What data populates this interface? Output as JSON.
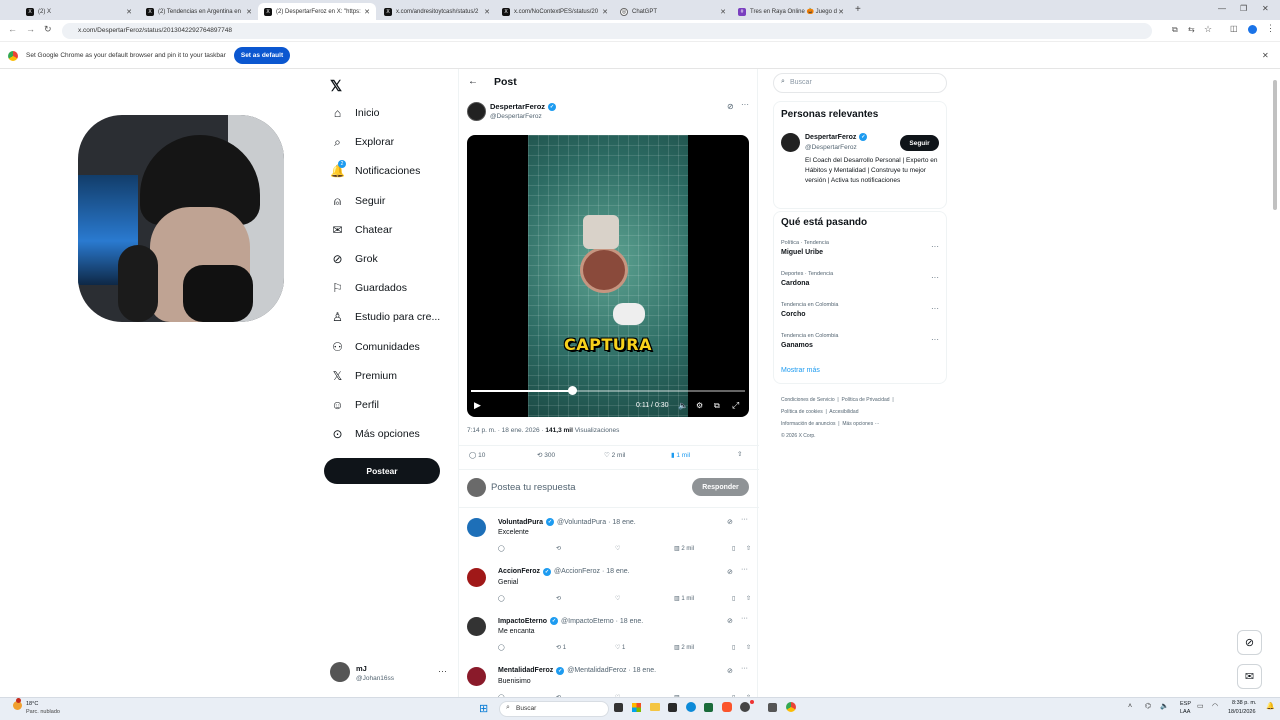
{
  "browser": {
    "tabs": [
      {
        "label": "(2) X",
        "active": false
      },
      {
        "label": "(2) Tendencias en Argentina en",
        "active": false
      },
      {
        "label": "(2) DespertarFeroz en X: \"https:",
        "active": true
      },
      {
        "label": "x.com/andresitoytcash/status/2",
        "active": false
      },
      {
        "label": "x.com/NoContextPES/status/20",
        "active": false
      },
      {
        "label": "ChatGPT",
        "active": false
      },
      {
        "label": "Tres en Raya Online 🎃 Juego d",
        "active": false
      }
    ],
    "url": "x.com/DespertarFeroz/status/2013042292764897748",
    "infobar_text": "Set Google Chrome as your default browser and pin it to your taskbar",
    "infobar_button": "Set as default"
  },
  "nav": {
    "items": [
      {
        "label": "Inicio",
        "icon": "home-icon"
      },
      {
        "label": "Explorar",
        "icon": "search-icon"
      },
      {
        "label": "Notificaciones",
        "icon": "bell-icon",
        "badge": "2"
      },
      {
        "label": "Seguir",
        "icon": "person-add-icon"
      },
      {
        "label": "Chatear",
        "icon": "mail-icon"
      },
      {
        "label": "Grok",
        "icon": "grok-icon"
      },
      {
        "label": "Guardados",
        "icon": "bookmark-icon"
      },
      {
        "label": "Estudio para cre...",
        "icon": "studio-icon"
      },
      {
        "label": "Comunidades",
        "icon": "communities-icon"
      },
      {
        "label": "Premium",
        "icon": "x-logo-icon"
      },
      {
        "label": "Perfil",
        "icon": "profile-icon"
      },
      {
        "label": "Más opciones",
        "icon": "more-circle-icon"
      }
    ],
    "post_button": "Postear",
    "account": {
      "name": "mJ",
      "handle": "@Johan16ss"
    }
  },
  "post": {
    "header": "Post",
    "author": {
      "name": "DespertarFeroz",
      "handle": "@DespertarFeroz"
    },
    "video": {
      "caption": "CAPTURA",
      "time": "0:11 / 0:30",
      "progress": 0.37
    },
    "meta_time": "7:14 p. m. · 18 ene. 2026 · ",
    "views_count": "141,3 mil",
    "views_label": "Visualizaciones",
    "stats": {
      "replies": "10",
      "reposts": "300",
      "likes": "2 mil",
      "bookmarks": "1 mil"
    },
    "reply_placeholder": "Postea tu respuesta",
    "reply_button": "Responder"
  },
  "replies": [
    {
      "name": "VoluntadPura",
      "handle": "@VoluntadPura · 18 ene.",
      "text": "Excelente",
      "reposts": "",
      "likes": "",
      "views": "2 mil",
      "avatar_color": "#1d6fb8"
    },
    {
      "name": "AccionFeroz",
      "handle": "@AccionFeroz · 18 ene.",
      "text": "Genial",
      "reposts": "",
      "likes": "",
      "views": "1 mil",
      "avatar_color": "#a01818"
    },
    {
      "name": "ImpactoEterno",
      "handle": "@ImpactoEterno · 18 ene.",
      "text": "Me encanta",
      "reposts": "1",
      "likes": "1",
      "views": "2 mil",
      "avatar_color": "#333333"
    },
    {
      "name": "MentalidadFeroz",
      "handle": "@MentalidadFeroz · 18 ene.",
      "text": "Buenisimo",
      "reposts": "",
      "likes": "",
      "views": "",
      "avatar_color": "#8a1a2a"
    }
  ],
  "right": {
    "search_placeholder": "Buscar",
    "relevant_title": "Personas relevantes",
    "relevant": {
      "name": "DespertarFeroz",
      "handle": "@DespertarFeroz",
      "bio": "El Coach del Desarrollo Personal | Experto en Hábitos y Mentalidad | Construye tu mejor versión | Activa tus notificaciones",
      "follow": "Seguir"
    },
    "trending_title": "Qué está pasando",
    "trends": [
      {
        "category": "Política · Tendencia",
        "name": "Miguel Uribe"
      },
      {
        "category": "Deportes · Tendencia",
        "name": "Cardona"
      },
      {
        "category": "Tendencia en Colombia",
        "name": "Corcho"
      },
      {
        "category": "Tendencia en Colombia",
        "name": "Ganamos"
      }
    ],
    "show_more": "Mostrar más",
    "footer": [
      "Condiciones de Servicio",
      "Política de Privacidad",
      "Política de cookies",
      "Accesibilidad",
      "Información de anuncios",
      "Más opciones ···",
      "© 2026 X Corp."
    ]
  },
  "taskbar": {
    "weather_temp": "18°C",
    "weather_desc": "Parc. nublado",
    "search": "Buscar",
    "lang": "ESP",
    "lang2": "LAA",
    "time": "8:38 p. m.",
    "date": "18/01/2026"
  }
}
